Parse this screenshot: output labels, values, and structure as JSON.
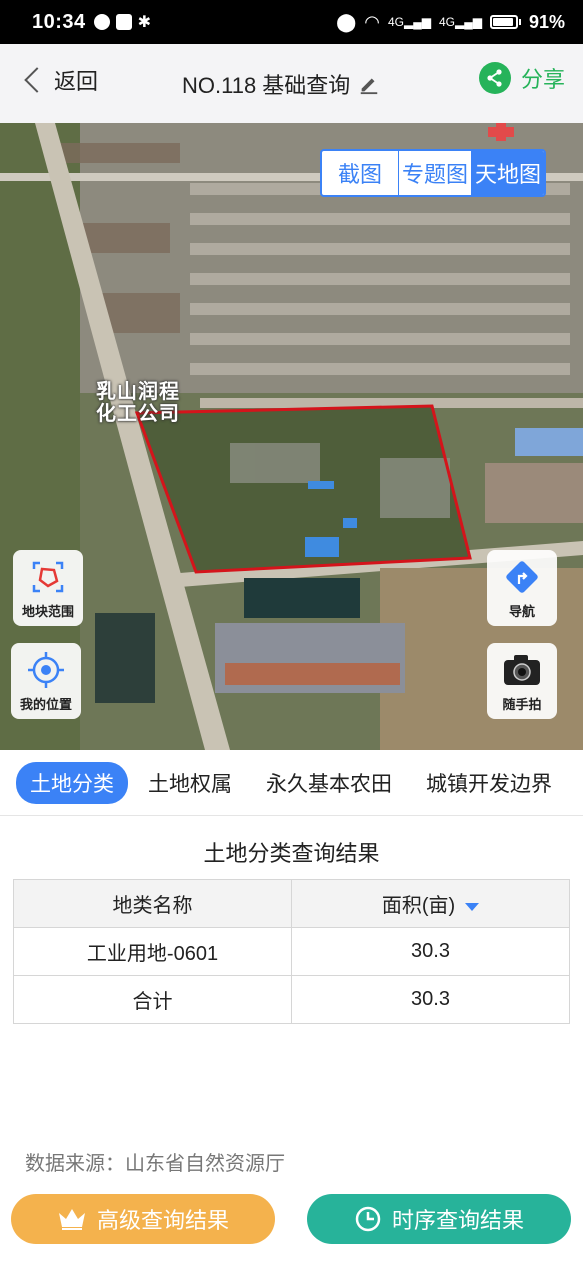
{
  "status_bar": {
    "time": "10:34",
    "network_1": "4G",
    "network_2": "4G",
    "battery": "91%"
  },
  "header": {
    "back_label": "返回",
    "title": "NO.118 基础查询",
    "share_label": "分享"
  },
  "map": {
    "toggle": [
      "截图",
      "专题图",
      "天地图"
    ],
    "active_toggle": "天地图",
    "poi_label_line1": "乳山润程",
    "poi_label_line2": "化工公司",
    "buttons": {
      "parcel_range": "地块范围",
      "my_location": "我的位置",
      "navigate": "导航",
      "snapshot": "随手拍"
    }
  },
  "tabs": [
    "土地分类",
    "土地权属",
    "永久基本农田",
    "城镇开发边界"
  ],
  "active_tab": "土地分类",
  "result": {
    "title": "土地分类查询结果",
    "columns": [
      "地类名称",
      "面积(亩)"
    ],
    "rows": [
      {
        "name": "工业用地-0601",
        "area": "30.3"
      },
      {
        "name": "合计",
        "area": "30.3"
      }
    ]
  },
  "source_text": "数据来源：山东省自然资源厅",
  "actions": {
    "advanced": "高级查询结果",
    "timeline": "时序查询结果"
  },
  "colors": {
    "accent": "#3b82f6",
    "share": "#26b35a",
    "advanced": "#f4b24d",
    "timeline": "#27b39a",
    "parcel_outline": "#d4141b"
  }
}
